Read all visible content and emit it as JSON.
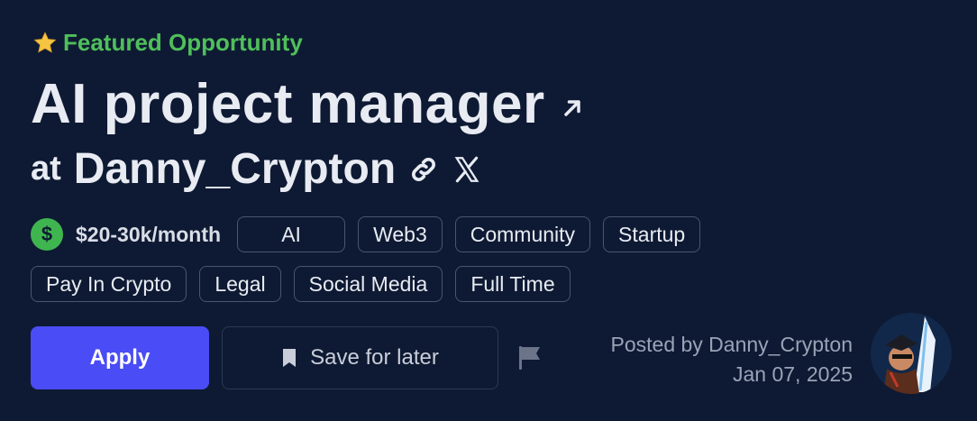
{
  "featured": {
    "label": "Featured Opportunity",
    "icon": "star-icon"
  },
  "job": {
    "title": "AI project manager",
    "at": "at",
    "company": "Danny_Crypton"
  },
  "salary": {
    "text": "$20-30k/month",
    "icon": "dollar-icon"
  },
  "tags_row1": [
    "AI",
    "Web3",
    "Community",
    "Startup"
  ],
  "tags_row2": [
    "Pay In Crypto",
    "Legal",
    "Social Media",
    "Full Time"
  ],
  "actions": {
    "apply": "Apply",
    "save": "Save for later"
  },
  "posted": {
    "by": "Posted by Danny_Crypton",
    "date": "Jan 07, 2025"
  },
  "colors": {
    "background": "#0e1a33",
    "accent": "#4a4cf5",
    "featured": "#4fbf5a",
    "salary": "#3fb54f"
  }
}
